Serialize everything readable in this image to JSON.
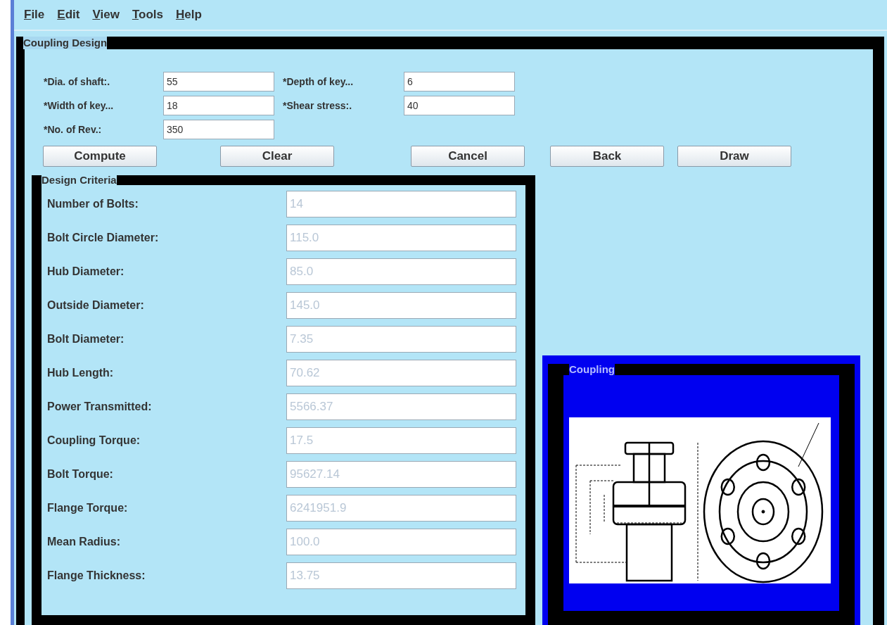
{
  "menu": [
    {
      "label": "File"
    },
    {
      "label": "Edit"
    },
    {
      "label": "View"
    },
    {
      "label": "Tools"
    },
    {
      "label": "Help"
    }
  ],
  "frame": {
    "title": "Coupling Design"
  },
  "inputs": [
    {
      "label": "*Dia. of shaft:.",
      "value": "55"
    },
    {
      "label": "*Depth of key...",
      "value": "6"
    },
    {
      "label": "*Width of key...",
      "value": "18"
    },
    {
      "label": "*Shear stress:.",
      "value": "40"
    },
    {
      "label": "*No. of Rev.:",
      "value": "350"
    }
  ],
  "buttons": [
    "Compute",
    "Clear",
    "Cancel",
    "Back",
    "Draw"
  ],
  "criteria": {
    "title": "Design Criteria",
    "rows": [
      {
        "label": "Number of Bolts:",
        "value": "14",
        "disabled": true
      },
      {
        "label": "Bolt Circle Diameter:",
        "value": "115.0",
        "disabled": true
      },
      {
        "label": "Hub Diameter:",
        "value": "85.0",
        "disabled": true
      },
      {
        "label": "Outside Diameter:",
        "value": "145.0",
        "disabled": true
      },
      {
        "label": "Bolt Diameter:",
        "value": "7.35",
        "disabled": true
      },
      {
        "label": "Hub Length:",
        "value": "70.62",
        "disabled": true
      },
      {
        "label": "Power Transmitted:",
        "value": "5566.37",
        "disabled": true
      },
      {
        "label": "Coupling Torque:",
        "value": "17.5",
        "disabled": true
      },
      {
        "label": "Bolt Torque:",
        "value": "95627.14",
        "disabled": true
      },
      {
        "label": "Flange Torque:",
        "value": "6241951.9",
        "disabled": true
      },
      {
        "label": "Mean Radius:",
        "value": "100.0",
        "disabled": true
      },
      {
        "label": "Flange Thickness:",
        "value": "13.75",
        "disabled": true
      }
    ]
  },
  "coupling": {
    "title": "Coupling"
  }
}
